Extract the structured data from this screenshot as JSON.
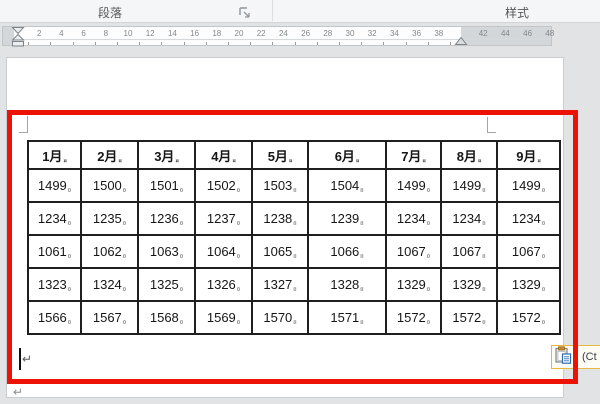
{
  "ribbon": {
    "paragraph_group_label": "段落",
    "styles_group_label": "样式",
    "launcher_icon": "dialog-launcher-icon"
  },
  "ruler": {
    "numbers": [
      2,
      4,
      6,
      8,
      10,
      12,
      14,
      16,
      18,
      20,
      22,
      24,
      26,
      28,
      30,
      32,
      34,
      36,
      38,
      42,
      44,
      46,
      48
    ]
  },
  "document": {
    "table": {
      "headers": [
        "1月",
        "2月",
        "3月",
        "4月",
        "5月",
        "6月",
        "7月",
        "8月",
        "9月"
      ],
      "rows": [
        [
          "1499",
          "1500",
          "1501",
          "1502",
          "1503",
          "1504",
          "1499",
          "1499",
          "1499"
        ],
        [
          "1234",
          "1235",
          "1236",
          "1237",
          "1238",
          "1239",
          "1234",
          "1234",
          "1234"
        ],
        [
          "1061",
          "1062",
          "1063",
          "1064",
          "1065",
          "1066",
          "1067",
          "1067",
          "1067"
        ],
        [
          "1323",
          "1324",
          "1325",
          "1326",
          "1327",
          "1328",
          "1329",
          "1329",
          "1329"
        ],
        [
          "1566",
          "1567",
          "1568",
          "1569",
          "1570",
          "1571",
          "1572",
          "1572",
          "1572"
        ]
      ],
      "cell_end_mark": "¤"
    },
    "paragraph_marks": [
      "↵",
      "↵"
    ]
  },
  "paste_options": {
    "shortcut_label": "(Ct",
    "icon": "clipboard-paste-icon"
  },
  "colors": {
    "annotation_red": "#ec1306",
    "paste_button_border": "#e7b73e",
    "table_border": "#1f1f1f",
    "page_white": "#ffffff",
    "canvas_gray": "#e2e3e4"
  }
}
